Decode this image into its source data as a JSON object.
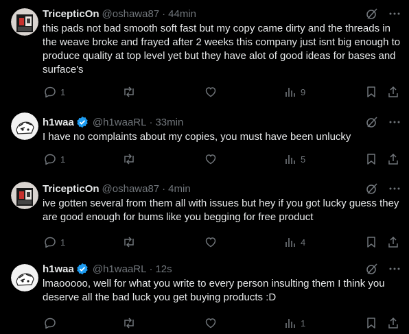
{
  "replies": [
    {
      "name": "TricepticOn",
      "handle": "@oshawa87",
      "time": "44min",
      "verified": false,
      "text": "this pads not bad smooth soft fast but my copy came dirty and the threads in the weave broke and frayed after 2 weeks this company just isnt big enough to produce quality at top level yet but they have alot of good ideas for bases and surface's",
      "replies_count": "1",
      "retweets_count": "",
      "likes_count": "",
      "views_count": "9"
    },
    {
      "name": "h1waa",
      "handle": "@h1waaRL",
      "time": "33min",
      "verified": true,
      "text": "I have no complaints about my copies, you must have been unlucky",
      "replies_count": "1",
      "retweets_count": "",
      "likes_count": "",
      "views_count": "5"
    },
    {
      "name": "TricepticOn",
      "handle": "@oshawa87",
      "time": "4min",
      "verified": false,
      "text": "ive gotten several from them all with issues but hey if you got lucky guess they are good enough for bums like you begging for free product",
      "replies_count": "1",
      "retweets_count": "",
      "likes_count": "",
      "views_count": "4"
    },
    {
      "name": "h1waa",
      "handle": "@h1waaRL",
      "time": "12s",
      "verified": true,
      "text": "lmaooooo, well for what you write to every person insulting them I think you deserve all the bad luck you get buying products :D",
      "replies_count": "",
      "retweets_count": "",
      "likes_count": "",
      "views_count": "1"
    }
  ],
  "colors": {
    "background": "#000000",
    "text": "#e7e9ea",
    "muted": "#71767b",
    "verified": "#1d9bf0"
  },
  "icons": {
    "grok": "grok-icon",
    "more": "more-icon",
    "reply": "reply-icon",
    "retweet": "retweet-icon",
    "like": "like-icon",
    "views": "views-icon",
    "bookmark": "bookmark-icon",
    "share": "share-icon"
  }
}
